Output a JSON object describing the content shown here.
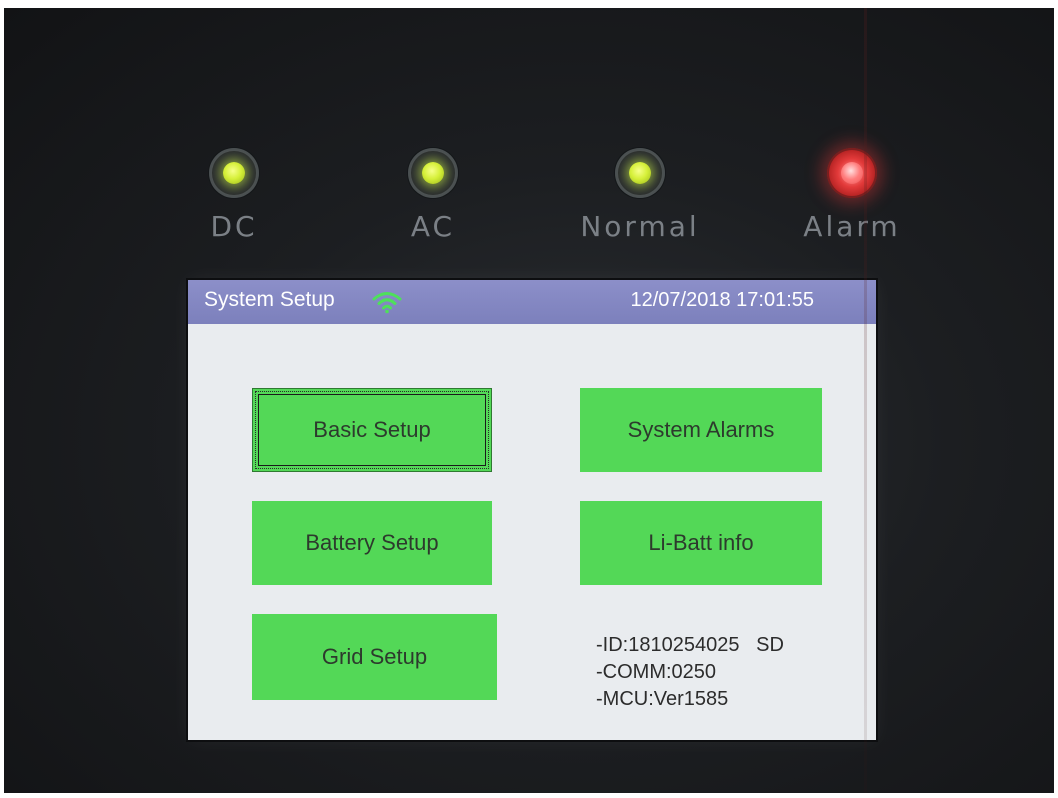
{
  "indicators": [
    {
      "label": "DC",
      "color": "green",
      "state": "on"
    },
    {
      "label": "AC",
      "color": "green",
      "state": "on"
    },
    {
      "label": "Normal",
      "color": "green",
      "state": "on"
    },
    {
      "label": "Alarm",
      "color": "red",
      "state": "on"
    }
  ],
  "screen": {
    "title": "System Setup",
    "status_icon": "wifi-icon",
    "datetime": "12/07/2018 17:01:55",
    "buttons": {
      "basic_setup": "Basic Setup",
      "system_alarms": "System Alarms",
      "battery_setup": "Battery Setup",
      "li_batt_info": "Li-Batt info",
      "grid_setup": "Grid Setup"
    },
    "info": {
      "id": "-ID:1810254025   SD",
      "comm": "-COMM:0250",
      "mcu": "-MCU:Ver1585"
    }
  },
  "colors": {
    "button_green": "#53d857",
    "titlebar": "#8c8fc9",
    "screen_bg": "#e9ecef",
    "led_green": "#d6f03a",
    "led_red": "#e33a3a"
  }
}
